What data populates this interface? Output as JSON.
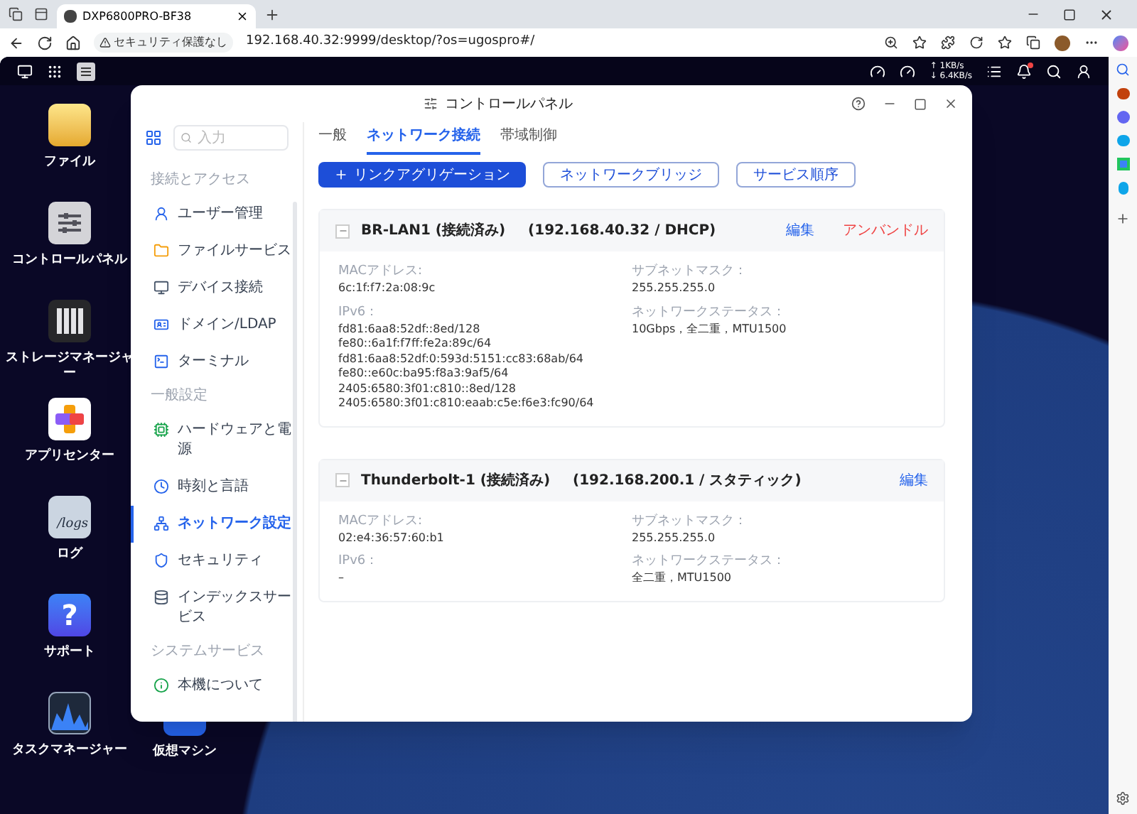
{
  "browser": {
    "tab_title": "DXP6800PRO-BF38",
    "security_label": "セキュリティ保護なし",
    "url": "192.168.40.32:9999/desktop/?os=ugospro#/"
  },
  "nas_topbar": {
    "upload": "↑ 1KB/s",
    "download": "↓ 6.4KB/s",
    "notification": true
  },
  "desktop_icons": [
    {
      "kind": "files",
      "label": "ファイル"
    },
    {
      "kind": "control",
      "label": "コントロールパネル"
    },
    {
      "kind": "storage",
      "label": "ストレージマネージャー"
    },
    {
      "kind": "apps",
      "label": "アプリセンター"
    },
    {
      "kind": "logs",
      "label": "ログ",
      "icon_text": "/logs"
    },
    {
      "kind": "support",
      "label": "サポート",
      "icon_text": "?"
    },
    {
      "kind": "taskmgr",
      "label": "タスクマネージャー"
    },
    {
      "kind": "vm",
      "label": "仮想マシン"
    }
  ],
  "window": {
    "title": "コントロールパネル",
    "search": {
      "placeholder": "入力"
    },
    "sidebar": [
      {
        "heading": "接続とアクセス",
        "items": [
          {
            "kind": "user",
            "label": "ユーザー管理",
            "selected": false
          },
          {
            "kind": "folder",
            "label": "ファイルサービス",
            "selected": false
          },
          {
            "kind": "device",
            "label": "デバイス接続",
            "selected": false
          },
          {
            "kind": "domain",
            "label": "ドメイン/LDAP",
            "selected": false
          },
          {
            "kind": "terminal",
            "label": "ターミナル",
            "selected": false
          }
        ]
      },
      {
        "heading": "一般設定",
        "items": [
          {
            "kind": "hardware",
            "label": "ハードウェアと電源",
            "selected": false
          },
          {
            "kind": "clock",
            "label": "時刻と言語",
            "selected": false
          },
          {
            "kind": "network",
            "label": "ネットワーク設定",
            "selected": true
          },
          {
            "kind": "security",
            "label": "セキュリティ",
            "selected": false
          },
          {
            "kind": "index",
            "label": "インデックスサービス",
            "selected": false
          }
        ]
      },
      {
        "heading": "システムサービス",
        "items": [
          {
            "kind": "info",
            "label": "本機について",
            "selected": false
          }
        ]
      }
    ],
    "tabs": [
      {
        "label": "一般",
        "selected": false
      },
      {
        "label": "ネットワーク接続",
        "selected": true
      },
      {
        "label": "帯域制御",
        "selected": false
      }
    ],
    "buttons": [
      {
        "kind": "primary",
        "label": "リンクアグリゲーション"
      },
      {
        "kind": "outline",
        "label": "ネットワークブリッジ"
      },
      {
        "kind": "outline",
        "label": "サービス順序"
      }
    ],
    "interfaces": [
      {
        "name": "BR-LAN1 (接続済み)",
        "address": "(192.168.40.32 / DHCP)",
        "expanded": true,
        "actions": [
          {
            "kind": "link",
            "label": "編集"
          },
          {
            "kind": "danger",
            "label": "アンバンドル"
          }
        ],
        "left": [
          {
            "label": "MACアドレス:",
            "values": [
              "6c:1f:f7:2a:08:9c"
            ]
          },
          {
            "label": "IPv6：",
            "values": [
              "fd81:6aa8:52df::8ed/128",
              "fe80::6a1f:f7ff:fe2a:89c/64",
              "fd81:6aa8:52df:0:593d:5151:cc83:68ab/64",
              "fe80::e60c:ba95:f8a3:9af5/64",
              "2405:6580:3f01:c810::8ed/128",
              "2405:6580:3f01:c810:eaab:c5e:f6e3:fc90/64"
            ]
          }
        ],
        "right": [
          {
            "label": "サブネットマスク：",
            "values": [
              "255.255.255.0"
            ]
          },
          {
            "label": "ネットワークステータス：",
            "values": [
              "10Gbps，全二重，MTU1500"
            ]
          }
        ]
      },
      {
        "name": "Thunderbolt-1 (接続済み)",
        "address": "(192.168.200.1 / スタティック)",
        "expanded": true,
        "actions": [
          {
            "kind": "link",
            "label": "編集"
          }
        ],
        "left": [
          {
            "label": "MACアドレス:",
            "values": [
              "02:e4:36:57:60:b1"
            ]
          },
          {
            "label": "IPv6：",
            "values": [
              "–"
            ]
          }
        ],
        "right": [
          {
            "label": "サブネットマスク：",
            "values": [
              "255.255.255.0"
            ]
          },
          {
            "label": "ネットワークステータス：",
            "values": [
              "全二重，MTU1500"
            ]
          }
        ]
      }
    ]
  }
}
